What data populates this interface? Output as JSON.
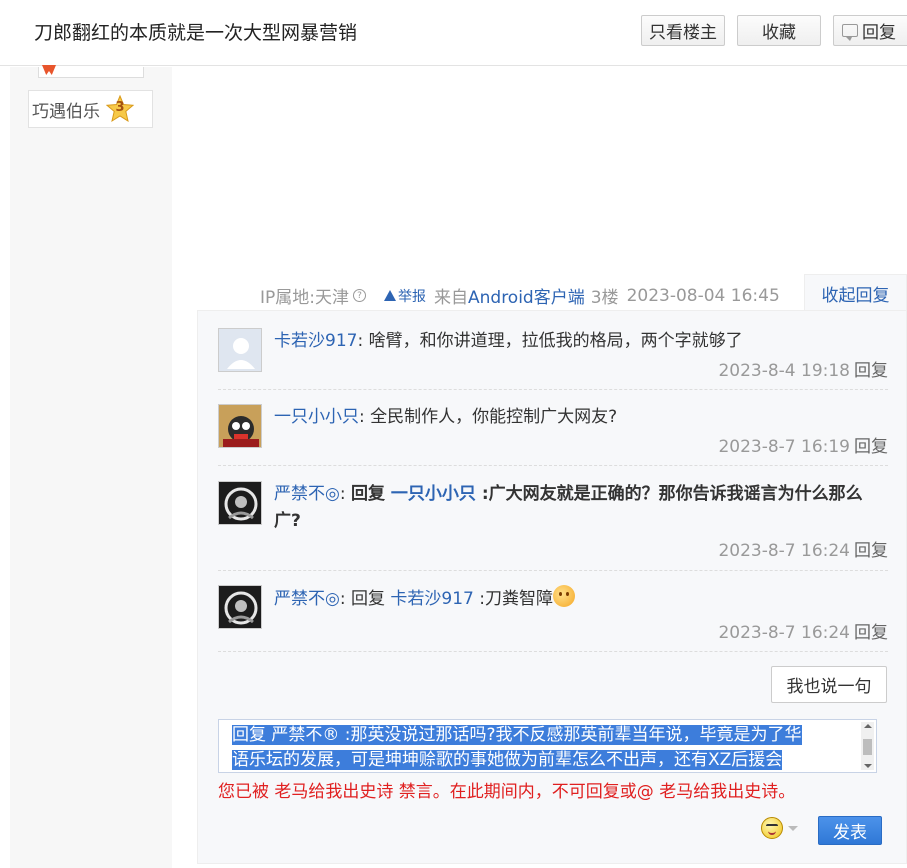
{
  "header": {
    "title": "刀郎翻红的本质就是一次大型网暴营销",
    "only_op_label": "只看楼主",
    "favorite_label": "收藏",
    "reply_label": "回复"
  },
  "sidebar": {
    "level_name": "巧遇伯乐",
    "level_number": "3"
  },
  "post_meta": {
    "ip": "IP属地:天津",
    "help_icon": "?",
    "report": "举报",
    "source_prefix": "来自",
    "source_client": "Android客户端",
    "floor": "3楼",
    "datetime": "2023-08-04 16:45",
    "collapse_label": "收起回复"
  },
  "comments": [
    {
      "user": "卡若沙917",
      "sep": ": ",
      "content": "啥臂，和你讲道理，拉低我的格局，两个字就够了",
      "time": "2023-8-4 19:18",
      "reply": "回复"
    },
    {
      "user": "一只小小只",
      "sep": ": ",
      "content": "全民制作人，你能控制广大网友?",
      "time": "2023-8-7 16:19",
      "reply": "回复"
    },
    {
      "user": "严禁不◎",
      "sep": ": ",
      "reply_word": "回复 ",
      "target": "一只小小只",
      "content": " :广大网友就是正确的？那你告诉我谣言为什么那么广?",
      "time": "2023-8-7 16:24",
      "reply": "回复"
    },
    {
      "user": "严禁不◎",
      "sep": ": ",
      "reply_word": "回复 ",
      "target": "卡若沙917",
      "content": " :刀粪智障",
      "time": "2023-8-7 16:24",
      "reply": "回复"
    }
  ],
  "say_button": "我也说一句",
  "editor": {
    "line1": "回复 严禁不® :那英没说过那话吗?我不反感那英前辈当年说，毕竟是为了华",
    "line2": "语乐坛的发展，可是坤坤赊歌的事她做为前辈怎么不出声，还有XZ后援会"
  },
  "ban_message": "您已被 老马给我出史诗 禁言。在此期间内，不可回复或@ 老马给我出史诗。",
  "submit_label": "发表",
  "colors": {
    "link": "#2d64b3",
    "error": "#e02020",
    "selection": "#3d7ddb",
    "submit": "#2f78d6"
  }
}
